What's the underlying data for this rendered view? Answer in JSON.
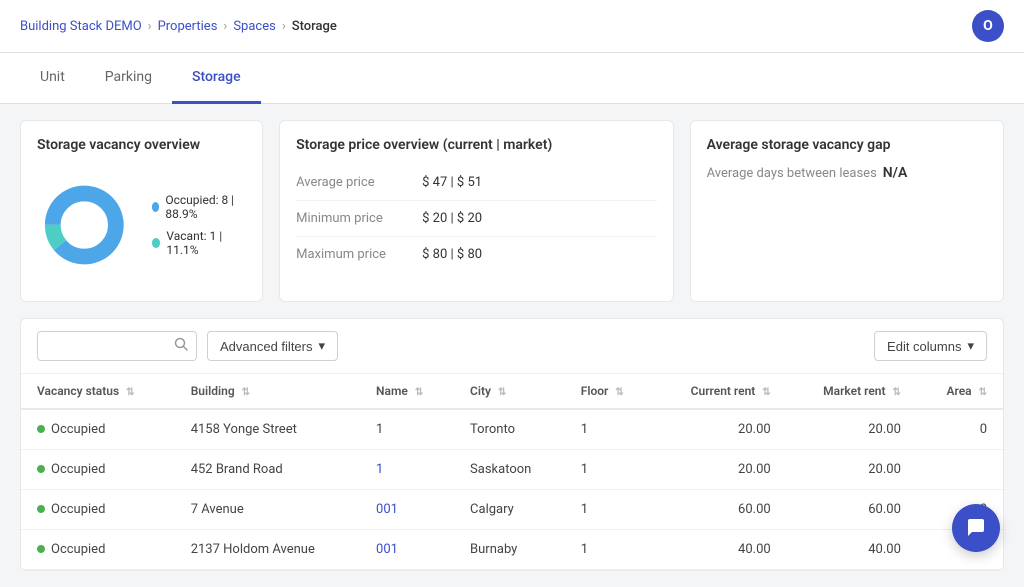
{
  "breadcrumb": {
    "parts": [
      {
        "label": "Building Stack DEMO",
        "href": true
      },
      {
        "label": "Properties",
        "href": true
      },
      {
        "label": "Spaces",
        "href": true
      },
      {
        "label": "Storage",
        "href": false
      }
    ],
    "separator": ">"
  },
  "avatar": {
    "initials": "O"
  },
  "tabs": [
    {
      "label": "Unit",
      "active": false
    },
    {
      "label": "Parking",
      "active": false
    },
    {
      "label": "Storage",
      "active": true
    }
  ],
  "cards": {
    "vacancy": {
      "title": "Storage vacancy overview",
      "chart": {
        "occupied_pct": 88.9,
        "vacant_pct": 11.1
      },
      "legend": [
        {
          "label": "Occupied: 8 | 88.9%",
          "color": "#4da6e8"
        },
        {
          "label": "Vacant: 1 | 11.1%",
          "color": "#4ecdc4"
        }
      ]
    },
    "price": {
      "title": "Storage price overview (current | market)",
      "rows": [
        {
          "label": "Average price",
          "value": "$ 47 | $ 51"
        },
        {
          "label": "Minimum price",
          "value": "$ 20 | $ 20"
        },
        {
          "label": "Maximum price",
          "value": "$ 80 | $ 80"
        }
      ]
    },
    "gap": {
      "title": "Average storage vacancy gap",
      "label": "Average days between leases",
      "value": "N/A"
    }
  },
  "toolbar": {
    "search_placeholder": "",
    "filter_label": "Advanced filters",
    "filter_chevron": "▾",
    "edit_columns_label": "Edit columns",
    "edit_columns_chevron": "▾"
  },
  "table": {
    "columns": [
      {
        "label": "Vacancy status",
        "key": "status"
      },
      {
        "label": "Building",
        "key": "building"
      },
      {
        "label": "Name",
        "key": "name"
      },
      {
        "label": "City",
        "key": "city"
      },
      {
        "label": "Floor",
        "key": "floor"
      },
      {
        "label": "Current rent",
        "key": "current_rent",
        "align": "right"
      },
      {
        "label": "Market rent",
        "key": "market_rent",
        "align": "right"
      },
      {
        "label": "Area",
        "key": "area",
        "align": "right"
      }
    ],
    "rows": [
      {
        "status": "Occupied",
        "status_color": "#4caf50",
        "building": "4158 Yonge Street",
        "name": "1",
        "name_link": false,
        "city": "Toronto",
        "floor": "1",
        "current_rent": "20.00",
        "market_rent": "20.00",
        "area": "0"
      },
      {
        "status": "Occupied",
        "status_color": "#4caf50",
        "building": "452 Brand Road",
        "name": "1",
        "name_link": true,
        "city": "Saskatoon",
        "floor": "1",
        "current_rent": "20.00",
        "market_rent": "20.00",
        "area": ""
      },
      {
        "status": "Occupied",
        "status_color": "#4caf50",
        "building": "7 Avenue",
        "name": "001",
        "name_link": true,
        "city": "Calgary",
        "floor": "1",
        "current_rent": "60.00",
        "market_rent": "60.00",
        "area": "0"
      },
      {
        "status": "Occupied",
        "status_color": "#4caf50",
        "building": "2137 Holdom Avenue",
        "name": "001",
        "name_link": true,
        "city": "Burnaby",
        "floor": "1",
        "current_rent": "40.00",
        "market_rent": "40.00",
        "area": ""
      }
    ]
  }
}
